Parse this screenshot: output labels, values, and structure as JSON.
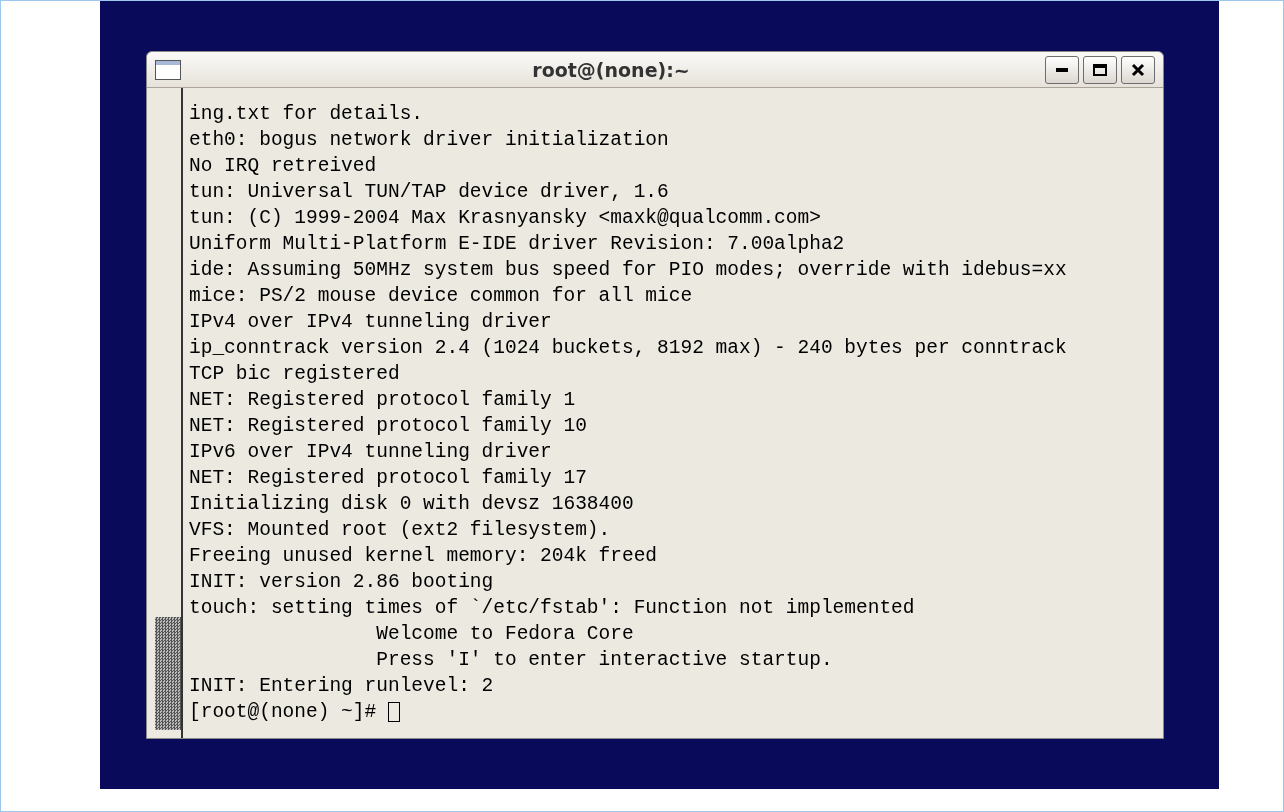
{
  "window": {
    "title": "root@(none):~"
  },
  "terminal": {
    "lines": [
      "ing.txt for details.",
      "eth0: bogus network driver initialization",
      "No IRQ retreived",
      "tun: Universal TUN/TAP device driver, 1.6",
      "tun: (C) 1999-2004 Max Krasnyansky <maxk@qualcomm.com>",
      "Uniform Multi-Platform E-IDE driver Revision: 7.00alpha2",
      "ide: Assuming 50MHz system bus speed for PIO modes; override with idebus=xx",
      "mice: PS/2 mouse device common for all mice",
      "IPv4 over IPv4 tunneling driver",
      "ip_conntrack version 2.4 (1024 buckets, 8192 max) - 240 bytes per conntrack",
      "TCP bic registered",
      "NET: Registered protocol family 1",
      "NET: Registered protocol family 10",
      "IPv6 over IPv4 tunneling driver",
      "NET: Registered protocol family 17",
      "Initializing disk 0 with devsz 1638400",
      "VFS: Mounted root (ext2 filesystem).",
      "Freeing unused kernel memory: 204k freed",
      "INIT: version 2.86 booting",
      "touch: setting times of `/etc/fstab': Function not implemented",
      "                Welcome to Fedora Core",
      "                Press 'I' to enter interactive startup.",
      "INIT: Entering runlevel: 2"
    ],
    "prompt": "[root@(none) ~]#"
  }
}
